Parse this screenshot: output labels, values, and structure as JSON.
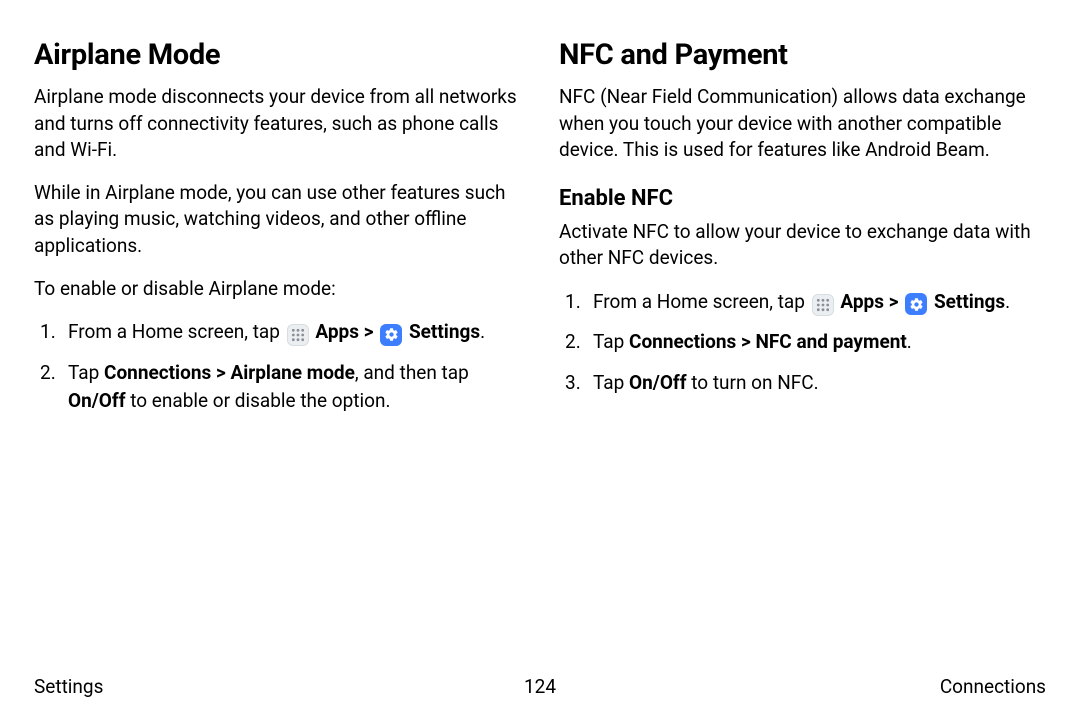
{
  "left": {
    "heading": "Airplane Mode",
    "p1": "Airplane mode disconnects your device from all networks and turns off connectivity features, such as phone calls and Wi-Fi.",
    "p2": "While in Airplane mode, you can use other features such as playing music, watching videos, and other offline applications.",
    "p3": "To enable or disable Airplane mode:",
    "step1_prefix": "From a Home screen, tap ",
    "step1_apps": "Apps",
    "step1_arrow": " > ",
    "step1_settings": "Settings",
    "step1_period": ".",
    "step2_prefix": "Tap ",
    "step2_bold": "Connections > Airplane mode",
    "step2_mid": ", and then tap ",
    "step2_onoff": "On/Off",
    "step2_suffix": " to enable or disable the option."
  },
  "right": {
    "heading": "NFC and Payment",
    "p1": "NFC (Near Field Communication) allows data exchange when you touch your device with another compatible device. This is used for features like Android Beam.",
    "sub": "Enable NFC",
    "p2": "Activate NFC to allow your device to exchange data with other NFC devices.",
    "step1_prefix": "From a Home screen, tap ",
    "step1_apps": "Apps",
    "step1_arrow": " > ",
    "step1_settings": "Settings",
    "step1_period": ".",
    "step2_prefix": "Tap ",
    "step2_bold": "Connections > NFC and payment",
    "step2_period": ".",
    "step3_prefix": "Tap ",
    "step3_onoff": "On/Off",
    "step3_suffix": " to turn on NFC."
  },
  "footer": {
    "left": "Settings",
    "center": "124",
    "right": "Connections"
  }
}
